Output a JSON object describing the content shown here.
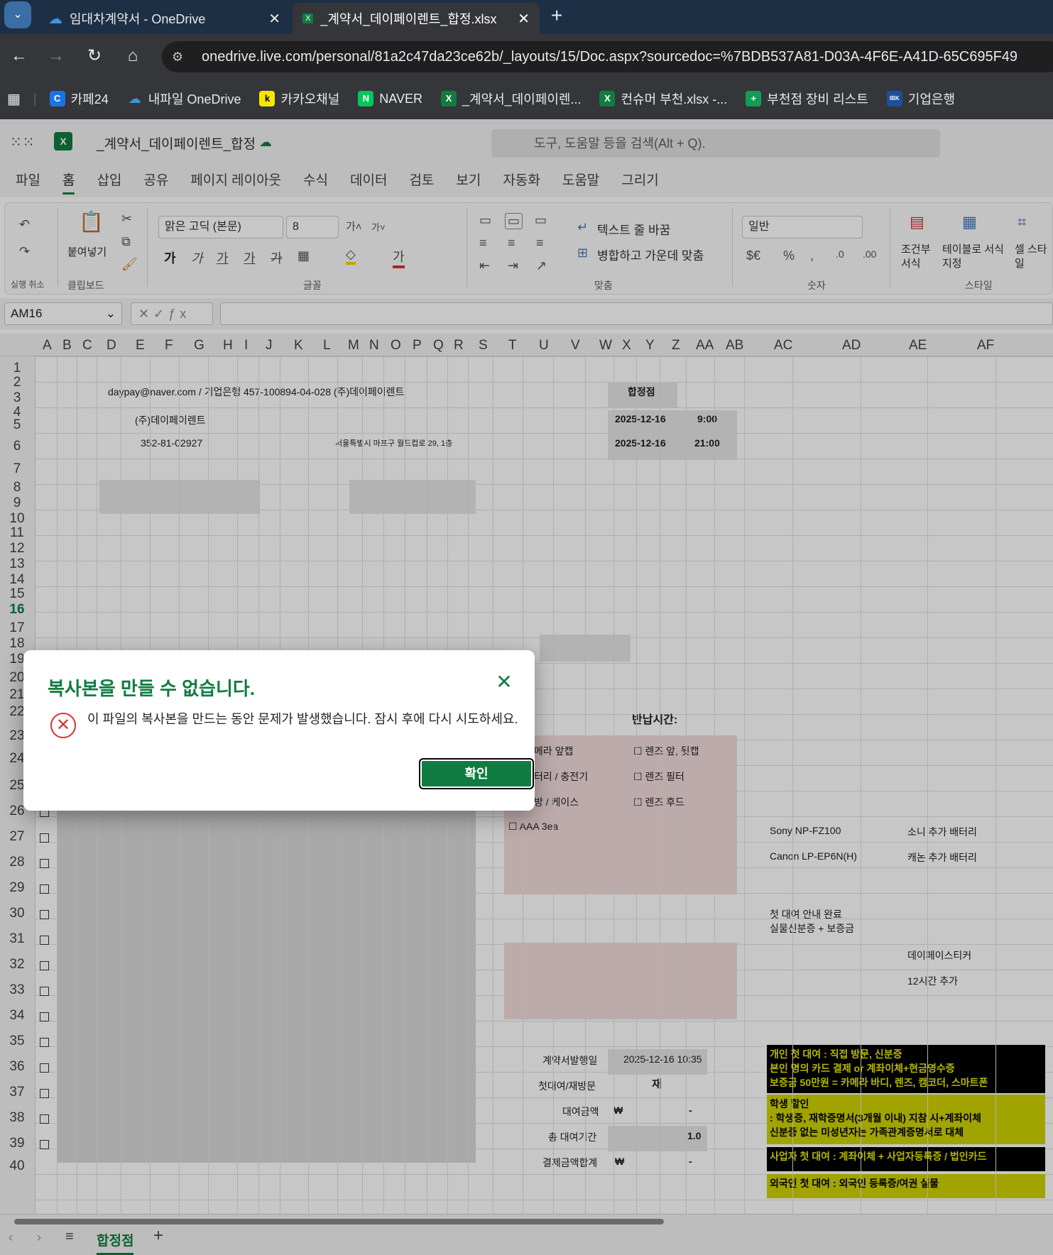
{
  "browser": {
    "tabs": [
      {
        "title": "임대차계약서 - OneDrive",
        "active": false
      },
      {
        "title": "_계약서_데이페이렌트_합정.xlsx",
        "active": true
      }
    ],
    "url": "onedrive.live.com/personal/81a2c47da23ce62b/_layouts/15/Doc.aspx?sourcedoc=%7BDB537A81-D03A-4F6E-A41D-65C695F49",
    "bookmarks": [
      {
        "label": "카페24",
        "icon": "C",
        "color": "#1a73e8"
      },
      {
        "label": "내파일 OneDrive",
        "icon": "☁",
        "color": "#0f6cbd"
      },
      {
        "label": "카카오채널",
        "icon": "k",
        "color": "#f7e600"
      },
      {
        "label": "NAVER",
        "icon": "N",
        "color": "#03c75a"
      },
      {
        "label": "_계약서_데이페이렌...",
        "icon": "X",
        "color": "#107c41"
      },
      {
        "label": "컨슈머 부천.xlsx -...",
        "icon": "X",
        "color": "#107c41"
      },
      {
        "label": "부천점 장비 리스트",
        "icon": "+",
        "color": "#0f9d58"
      },
      {
        "label": "기업은행",
        "icon": "IBK",
        "color": "#1e4f9c"
      }
    ]
  },
  "excel": {
    "doc_title": "_계약서_데이페이렌트_합정",
    "search_placeholder": "도구, 도움말 등을 검색(Alt + Q).",
    "menu_tabs": [
      "파일",
      "홈",
      "삽입",
      "공유",
      "페이지 레이아웃",
      "수식",
      "데이터",
      "검토",
      "보기",
      "자동화",
      "도움말",
      "그리기"
    ],
    "active_tab": "홈",
    "ribbon": {
      "undo_label": "실행 취소",
      "paste_label": "붙여넣기",
      "clipboard_label": "클립보드",
      "font_name": "맑은 고딕 (본문)",
      "font_size": "8",
      "font_label": "글꼴",
      "wrap_text": "텍스트 줄 바꿈",
      "merge_center": "병합하고 가운데 맞춤",
      "align_label": "맞춤",
      "number_format": "일반",
      "number_label": "숫자",
      "cond_format": "조건부 서식",
      "table_format": "테이블로 서식 지정",
      "cell_style": "셀 스타일",
      "style_label": "스타일"
    },
    "name_box": "AM16",
    "columns": [
      "A",
      "B",
      "C",
      "D",
      "E",
      "F",
      "G",
      "H",
      "I",
      "J",
      "K",
      "L",
      "M",
      "N",
      "O",
      "P",
      "Q",
      "R",
      "S",
      "T",
      "U",
      "V",
      "W",
      "X",
      "Y",
      "Z",
      "AA",
      "AB",
      "AC",
      "AD",
      "AE",
      "AF"
    ],
    "rows": [
      "1",
      "2",
      "3",
      "4",
      "5",
      "6",
      "7",
      "8",
      "9",
      "10",
      "11",
      "12",
      "13",
      "14",
      "15",
      "16",
      "17",
      "18",
      "19",
      "20",
      "21",
      "22",
      "23",
      "24",
      "25",
      "26",
      "27",
      "28",
      "29",
      "30",
      "31",
      "32",
      "33",
      "34",
      "35",
      "36",
      "37",
      "38",
      "39",
      "40"
    ],
    "selected_row": "16",
    "cells": {
      "contact": "daypay@naver.com / 기업은행 457-100894-04-028 (주)데이페이렌트",
      "company": "(주)데이페이렌트",
      "biz_no": "352-81-02927",
      "address": "서울특별시 마포구 월드컵로 29, 1층",
      "branch": "합정점",
      "date1": "2025-12-16",
      "time1": "9:00",
      "date2": "2025-12-16",
      "time2": "21:00",
      "return_time": "반납시간:",
      "chk_cam_cap": "메라 앞캡",
      "chk_battery": "터리 / 충전기",
      "chk_case": "방 / 케이스",
      "chk_aaa": "☐ AAA 3ea",
      "chk_lens_cap": "☐ 렌즈 앞, 뒷캡",
      "chk_filter": "☐ 렌즈 필터",
      "chk_hood": "☐ 렌즈 후드",
      "sony_bat": "Sony NP-FZ100",
      "sony_bat_desc": "소니 추가 배터리",
      "canon_bat": "Canon LP-EP6N(H)",
      "canon_bat_desc": "캐논 추가 배터리",
      "first_rent_notice": "첫 대여 안내 완료",
      "first_rent_notice2": "실물신분증 + 보증금",
      "sticker": "데이페이스티커",
      "extra_12h": "12시간 추가",
      "issue_date_label": "계약서발행일",
      "issue_date": "2025-12-16 10:35",
      "visit_label": "첫대여/재방문",
      "visit_value": "재",
      "rent_amount_label": "대여금액",
      "rent_amount_cur": "₩",
      "rent_amount": "-",
      "total_period_label": "총 대여기간",
      "total_period": "1.0",
      "payment_total_label": "결제금액합계",
      "payment_total_cur": "₩",
      "payment_total": "-"
    },
    "notices": {
      "personal": [
        "개인 첫 대여 : 직접 방문, 신분증",
        "본인 명의 카드 결제 or 계좌이체+현금영수증",
        "보증금 50만원 = 카메라 바디, 렌즈, 캠코더, 스마트폰"
      ],
      "student": [
        "학생 할인",
        ": 학생증, 재학증명서(3개월 이내) 지참 시+계좌이체",
        "신분증 없는 미성년자는 가족관계증명서로 대체"
      ],
      "business": "사업자 첫 대여 : 계좌이체 + 사업자등록증   /   법인카드",
      "foreigner": "외국인 첫 대여 : 외국인 등록증/여권 실물"
    },
    "sheet_tab": "합정점"
  },
  "dialog": {
    "title": "복사본을 만들 수 없습니다.",
    "message": "이 파일의 복사본을 만드는 동안 문제가 발생했습니다. 잠시 후에 다시 시도하세요.",
    "ok_label": "확인"
  },
  "colors": {
    "excel_green": "#107c41",
    "error_red": "#d13438",
    "pink_fill": "#f2dcdc",
    "yellow_note": "#cfd300"
  }
}
